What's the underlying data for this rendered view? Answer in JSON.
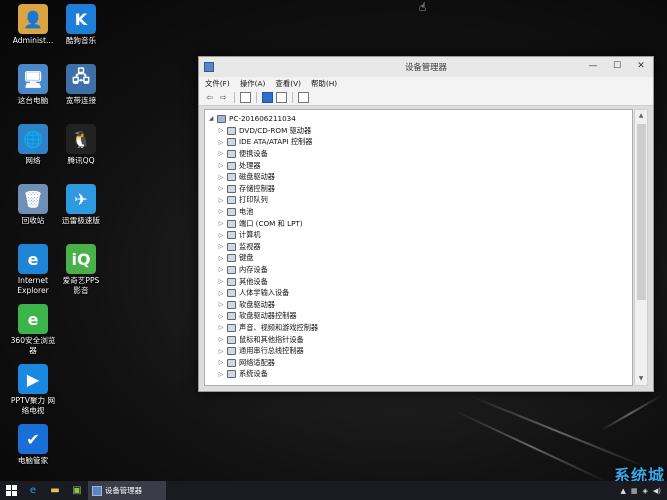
{
  "desktop": {
    "icons": [
      {
        "label": "Administ...",
        "glyph": "👤",
        "color": "#d9a441"
      },
      {
        "label": "酷狗音乐",
        "glyph": "K",
        "color": "#1d7fd8"
      },
      {
        "label": "这台电脑",
        "glyph": "🖥",
        "color": "#4a88c7"
      },
      {
        "label": "宽带连接",
        "glyph": "🖧",
        "color": "#3d6fa8"
      },
      {
        "label": "网络",
        "glyph": "🌐",
        "color": "#2f82c8"
      },
      {
        "label": "腾讯QQ",
        "glyph": "🐧",
        "color": "#222222"
      },
      {
        "label": "回收站",
        "glyph": "🗑",
        "color": "#6f8fb5"
      },
      {
        "label": "迅雷极速版",
        "glyph": "✈",
        "color": "#2e9ae0"
      },
      {
        "label": "Internet\nExplorer",
        "glyph": "e",
        "color": "#1d84d6"
      },
      {
        "label": "爱奇艺PPS\n影音",
        "glyph": "iQ",
        "color": "#49b04a"
      },
      {
        "label": "360安全浏览\n器",
        "glyph": "e",
        "color": "#3bb54a"
      },
      {
        "label": "PPTV聚力 网\n络电视",
        "glyph": "▶",
        "color": "#1a88e0"
      },
      {
        "label": "电脑管家",
        "glyph": "✔",
        "color": "#1a6fd6"
      }
    ]
  },
  "window": {
    "title": "设备管理器",
    "controls": {
      "minimize": "—",
      "maximize": "☐",
      "close": "✕"
    },
    "menu": [
      "文件(F)",
      "操作(A)",
      "查看(V)",
      "帮助(H)"
    ],
    "toolbar": {
      "back": "⇦",
      "forward": "⇨"
    },
    "tree": {
      "root": "PC-201606211034",
      "root_arrow": "◢",
      "item_arrow": "▷",
      "items": [
        "DVD/CD-ROM 驱动器",
        "IDE ATA/ATAPI 控制器",
        "便携设备",
        "处理器",
        "磁盘驱动器",
        "存储控制器",
        "打印队列",
        "电池",
        "端口 (COM 和 LPT)",
        "计算机",
        "监视器",
        "键盘",
        "内存设备",
        "其他设备",
        "人体学输入设备",
        "软盘驱动器",
        "软盘驱动器控制器",
        "声音、视频和游戏控制器",
        "鼠标和其他指针设备",
        "通用串行总线控制器",
        "网络适配器",
        "系统设备"
      ]
    }
  },
  "taskbar": {
    "task_label": "设备管理器"
  },
  "watermark": "系统城"
}
